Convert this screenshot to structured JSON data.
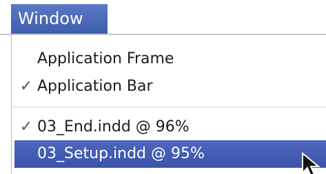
{
  "menu": {
    "title": "Window",
    "items": [
      {
        "label": "Application Frame",
        "checked": false
      },
      {
        "label": "Application Bar",
        "checked": true,
        "check": "✓"
      },
      {
        "label": "03_End.indd @ 96%",
        "checked": true,
        "check": "✓"
      },
      {
        "label": "03_Setup.indd @ 95%",
        "checked": false,
        "highlighted": true
      }
    ]
  },
  "colors": {
    "highlight": "#3f58ac",
    "menu_title_bg": "#4a68b8",
    "text": "#1c1c1c"
  },
  "icons": {
    "cursor": "arrow-cursor-icon",
    "check": "checkmark-icon"
  }
}
